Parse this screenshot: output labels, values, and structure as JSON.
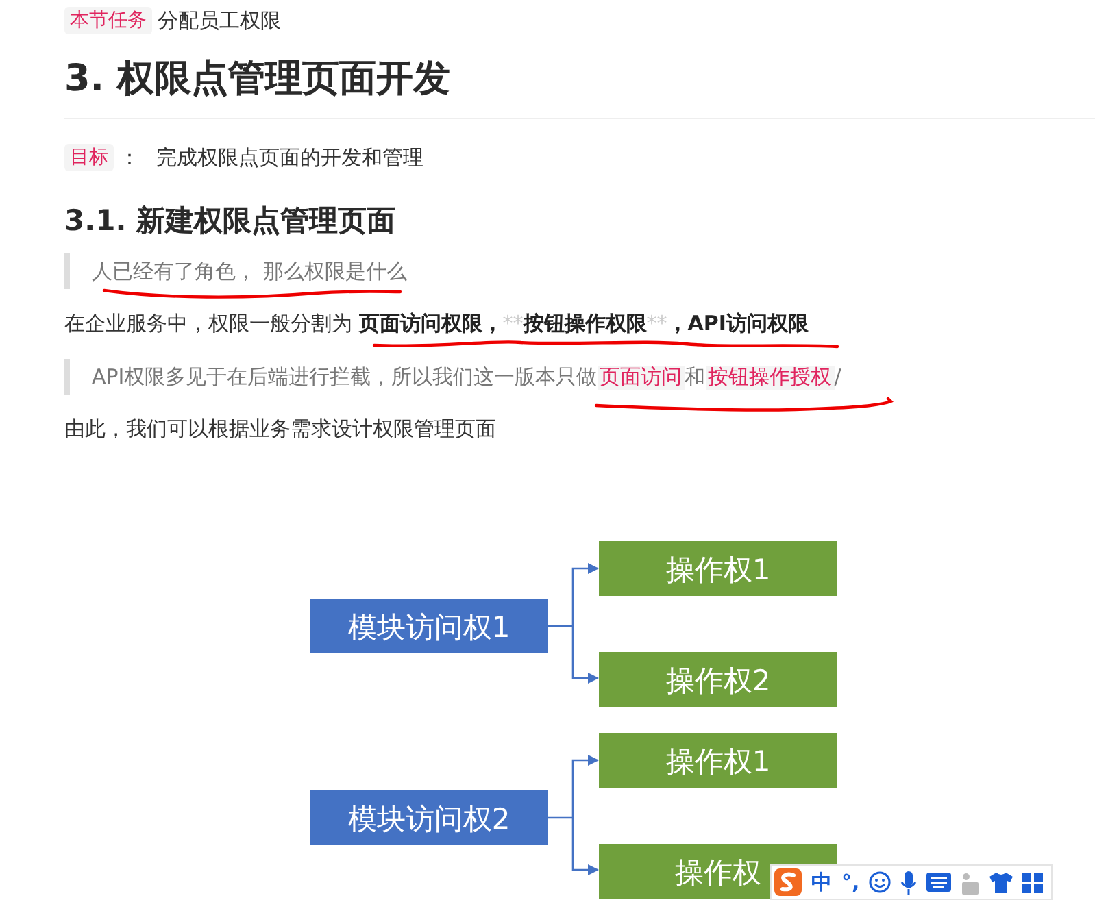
{
  "task": {
    "tag": "本节任务",
    "text": "分配员工权限"
  },
  "heading": "3. 权限点管理页面开发",
  "goal": {
    "tag": "目标",
    "sep": "：",
    "text": "完成权限点页面的开发和管理"
  },
  "subheading": "3.1. 新建权限点管理页面",
  "blocks": [
    {
      "kind": "quote",
      "parts": [
        {
          "kind": "plain",
          "text": "人已经有了角色，  那么权限是什么"
        }
      ]
    },
    {
      "kind": "para",
      "parts": [
        {
          "kind": "plain",
          "text": "在企业服务中，权限一般分割为 "
        },
        {
          "kind": "bold",
          "text": "页面访问权限，"
        },
        {
          "kind": "faint",
          "text": "**"
        },
        {
          "kind": "bold",
          "text": "按钮操作权限"
        },
        {
          "kind": "faint",
          "text": "**"
        },
        {
          "kind": "bold",
          "text": "，API访问权限"
        }
      ]
    },
    {
      "kind": "quote",
      "parts": [
        {
          "kind": "plain",
          "text": "API权限多见于在后端进行拦截，所以我们这一版本只做"
        },
        {
          "kind": "code",
          "text": "页面访问"
        },
        {
          "kind": "plain",
          "text": "和"
        },
        {
          "kind": "code",
          "text": "按钮操作授权"
        },
        {
          "kind": "plain",
          "text": "/"
        }
      ]
    },
    {
      "kind": "para",
      "parts": [
        {
          "kind": "plain",
          "text": "由此，我们可以根据业务需求设计权限管理页面"
        }
      ]
    }
  ],
  "diagram": {
    "groups": [
      {
        "module": "模块访问权1",
        "ops": [
          "操作权1",
          "操作权2"
        ]
      },
      {
        "module": "模块访问权2",
        "ops": [
          "操作权1",
          "操作权"
        ]
      }
    ]
  },
  "ime": {
    "mode": "中",
    "punct": "°,"
  }
}
